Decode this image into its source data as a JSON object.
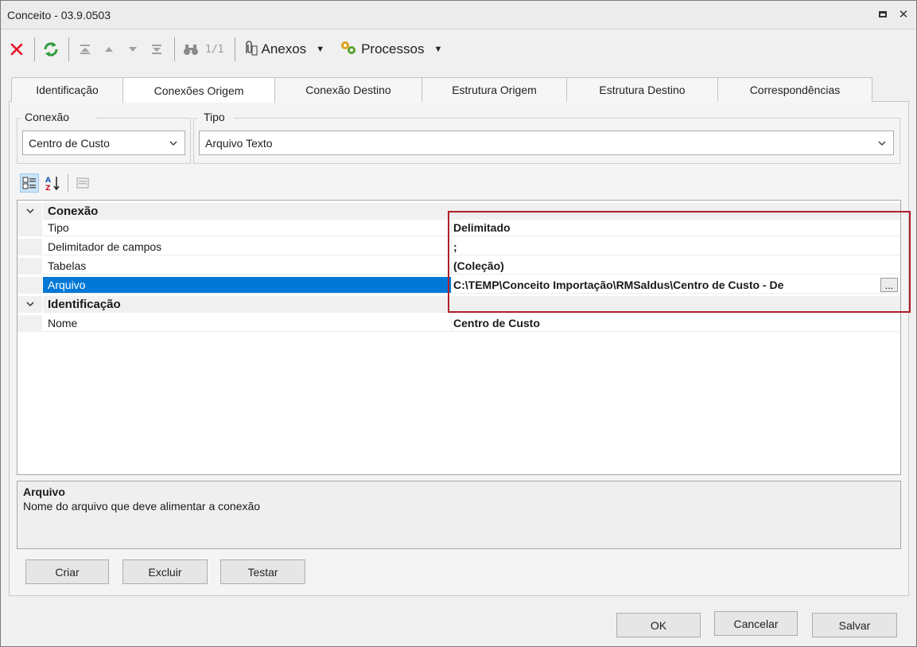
{
  "window": {
    "title": "Conceito - 03.9.0503"
  },
  "toolbar": {
    "pager": "1/1",
    "attachments_label": "Anexos",
    "processes_label": "Processos"
  },
  "tabs": [
    {
      "label": "Identificação"
    },
    {
      "label": "Conexões Origem"
    },
    {
      "label": "Conexão Destino"
    },
    {
      "label": "Estrutura Origem"
    },
    {
      "label": "Estrutura Destino"
    },
    {
      "label": "Correspondências"
    }
  ],
  "active_tab": "Conexões Origem",
  "connection": {
    "label": "Conexão",
    "value": "Centro de Custo"
  },
  "type": {
    "label": "Tipo",
    "value": "Arquivo Texto"
  },
  "grid": {
    "cat1": "Conexão",
    "cat2": "Identificação",
    "rows": [
      {
        "name": "Tipo",
        "value": "Delimitado"
      },
      {
        "name": "Delimitador de campos",
        "value": ";"
      },
      {
        "name": "Tabelas",
        "value": "(Coleção)"
      },
      {
        "name": "Arquivo",
        "value": "C:\\TEMP\\Conceito Importação\\RMSaldus\\Centro de Custo - De"
      },
      {
        "name": "Nome",
        "value": "Centro de Custo"
      }
    ],
    "ellipsis": "...",
    "selected_row": "Arquivo"
  },
  "help": {
    "title": "Arquivo",
    "description": "Nome do arquivo que deve alimentar a conexão"
  },
  "actions": {
    "create": "Criar",
    "delete": "Excluir",
    "test": "Testar"
  },
  "footer": {
    "ok": "OK",
    "cancel": "Cancelar",
    "save": "Salvar"
  },
  "colors": {
    "selection": "#0078d7",
    "highlight_box": "#b01e28",
    "delete_icon": "#e81123",
    "refresh_icon": "#2e9c3a"
  },
  "icons": [
    "close-x-icon",
    "refresh-icon",
    "first-record-icon",
    "previous-record-icon",
    "next-record-icon",
    "last-record-icon",
    "binoculars-icon",
    "paperclip-icon",
    "processes-gear-icon",
    "categorized-icon",
    "alphabetical-sort-icon",
    "property-pages-icon"
  ]
}
